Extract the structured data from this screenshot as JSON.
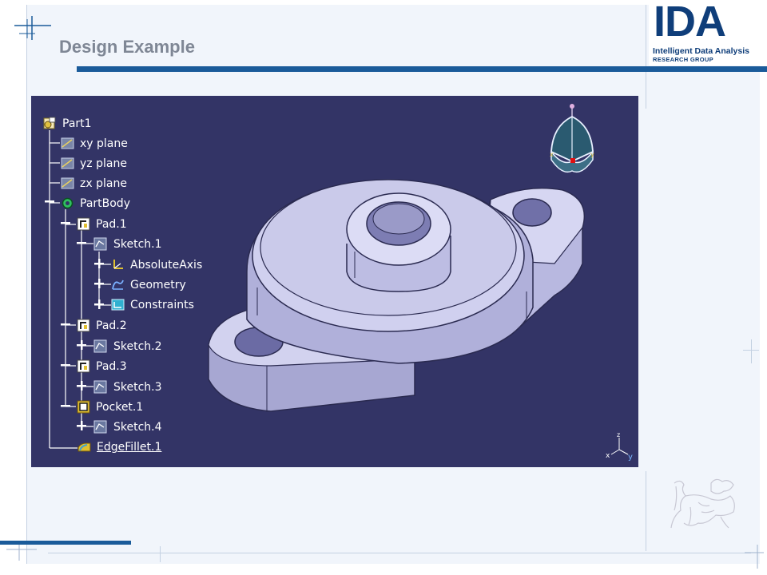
{
  "slide": {
    "title": "Design Example",
    "logo": {
      "letters": "IDA",
      "line1": "Intelligent Data Analysis",
      "line2": "RESEARCH GROUP"
    }
  },
  "spec_tree": {
    "root": "Part1",
    "nodes": [
      {
        "label": "xy plane"
      },
      {
        "label": "yz plane"
      },
      {
        "label": "zx plane"
      },
      {
        "label": "PartBody"
      },
      {
        "label": "Pad.1"
      },
      {
        "label": "Sketch.1"
      },
      {
        "label": "AbsoluteAxis"
      },
      {
        "label": "Geometry"
      },
      {
        "label": "Constraints"
      },
      {
        "label": "Pad.2"
      },
      {
        "label": "Sketch.2"
      },
      {
        "label": "Pad.3"
      },
      {
        "label": "Sketch.3"
      },
      {
        "label": "Pocket.1"
      },
      {
        "label": "Sketch.4"
      },
      {
        "label": "EdgeFillet.1"
      }
    ]
  },
  "compass": {
    "x_label": "x",
    "y_label": "y"
  },
  "axis_indicator": {
    "z": "z",
    "x": "x",
    "y": "y"
  },
  "colors": {
    "viewport_bg": "#333466",
    "accent": "#1a5b9a",
    "part_face": "#c9c9e8",
    "part_shadow": "#8f8fbf"
  }
}
